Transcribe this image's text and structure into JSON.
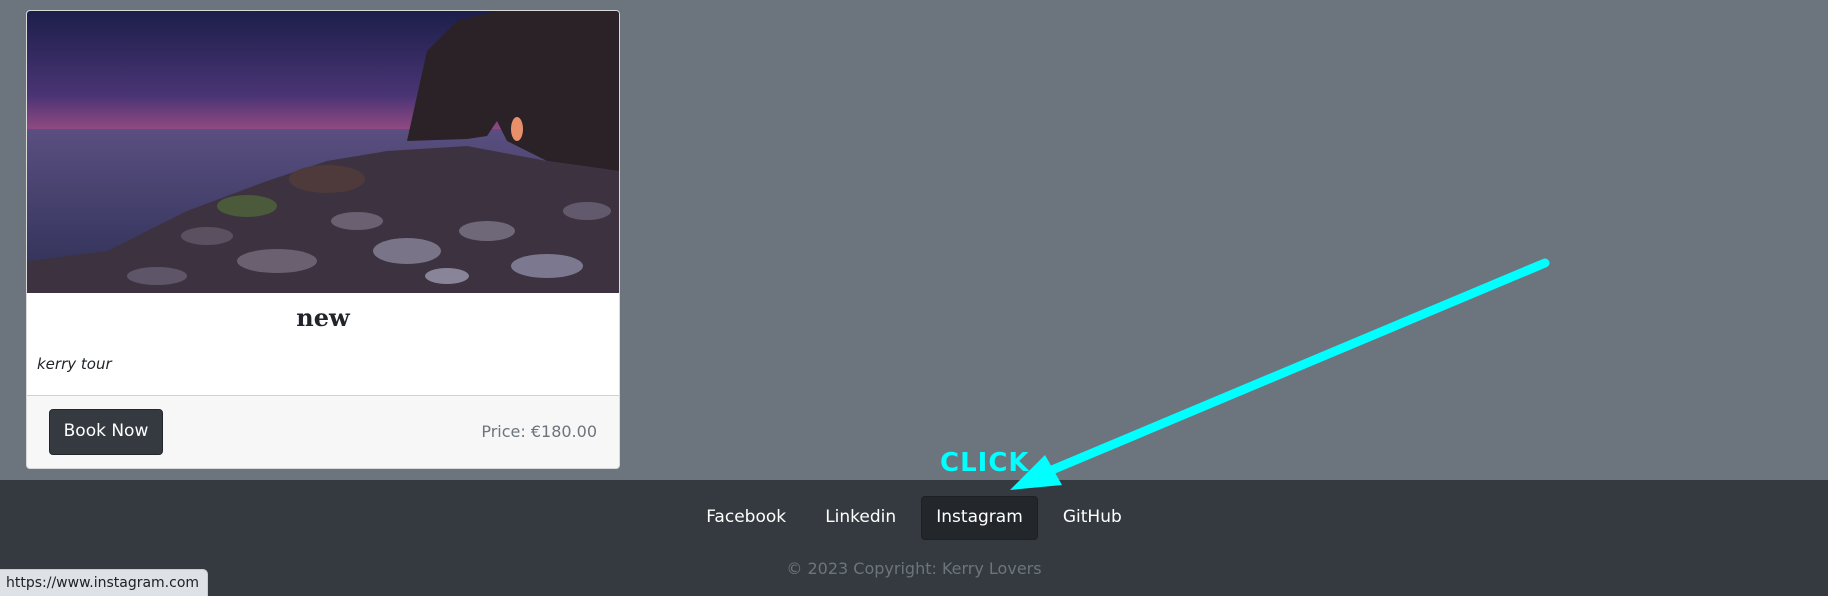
{
  "card": {
    "title": "new",
    "description": "kerry tour",
    "book_button_label": "Book Now",
    "price": "Price: €180.00",
    "image_icon": "coastal-sunset-photo"
  },
  "footer": {
    "social_links": [
      {
        "label": "Facebook"
      },
      {
        "label": "Linkedin"
      },
      {
        "label": "Instagram"
      },
      {
        "label": "GitHub"
      }
    ],
    "copyright": "© 2023 Copyright: Kerry Lovers"
  },
  "status_bar": {
    "url": "https://www.instagram.com"
  },
  "annotation": {
    "label": "CLICK",
    "color": "#00ffff"
  },
  "colors": {
    "page_background": "#6c757d",
    "footer_background": "#343a40",
    "button_dark": "#343a40"
  }
}
